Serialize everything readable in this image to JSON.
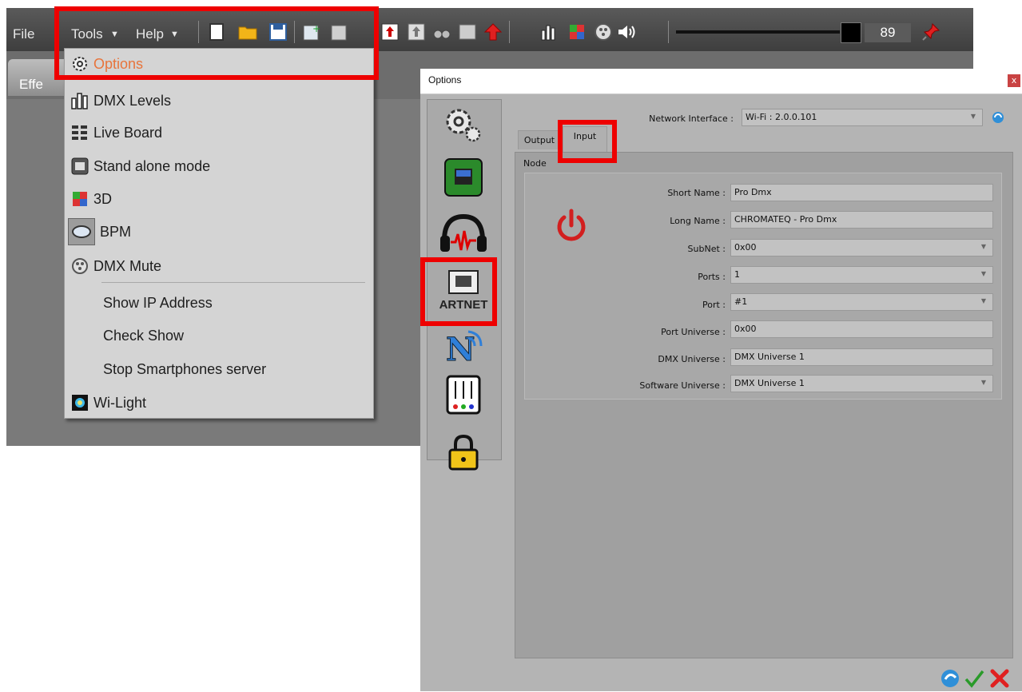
{
  "menubar": {
    "file": "File",
    "tools": "Tools",
    "help": "Help"
  },
  "effects_tab": "Effe",
  "volume": {
    "value": "89"
  },
  "tools_menu": {
    "items": [
      {
        "label": "Options",
        "icon": "gear-icon",
        "color": "#e8743b"
      },
      {
        "label": "DMX Levels",
        "icon": "bar-chart-icon"
      },
      {
        "label": "Live Board",
        "icon": "grid-icon"
      },
      {
        "label": "Stand alone mode",
        "icon": "device-icon"
      },
      {
        "label": "3D",
        "icon": "cube-icon"
      },
      {
        "label": "BPM",
        "icon": "disc-icon"
      },
      {
        "label": "DMX Mute",
        "icon": "mute-icon"
      },
      {
        "label": "Show IP Address"
      },
      {
        "label": "Check Show"
      },
      {
        "label": "Stop Smartphones server"
      },
      {
        "label": "Wi-Light",
        "icon": "wi-light-icon"
      }
    ]
  },
  "dialog": {
    "title": "Options",
    "close": "x",
    "network_label": "Network Interface :",
    "network_value": "Wi-Fi : 2.0.0.101",
    "tabs": [
      "Output",
      "Input"
    ],
    "group_title": "Node",
    "artnet_label": "ARTNET",
    "power_color": "#d21f1f",
    "fields": [
      {
        "label": "Short Name :",
        "value": "Pro Dmx",
        "type": "text"
      },
      {
        "label": "Long Name :",
        "value": "CHROMATEQ - Pro Dmx",
        "type": "text"
      },
      {
        "label": "SubNet :",
        "value": "0x00",
        "type": "combo"
      },
      {
        "label": "Ports :",
        "value": "1",
        "type": "combo"
      },
      {
        "label": "Port :",
        "value": "#1",
        "type": "combo"
      },
      {
        "label": "Port Universe :",
        "value": "0x00",
        "type": "text"
      },
      {
        "label": "DMX Universe :",
        "value": "DMX Universe 1",
        "type": "text"
      },
      {
        "label": "Software Universe :",
        "value": "DMX Universe 1",
        "type": "combo"
      }
    ]
  },
  "colors": {
    "highlight": "#ee0000",
    "accent_orange": "#e8743b"
  }
}
